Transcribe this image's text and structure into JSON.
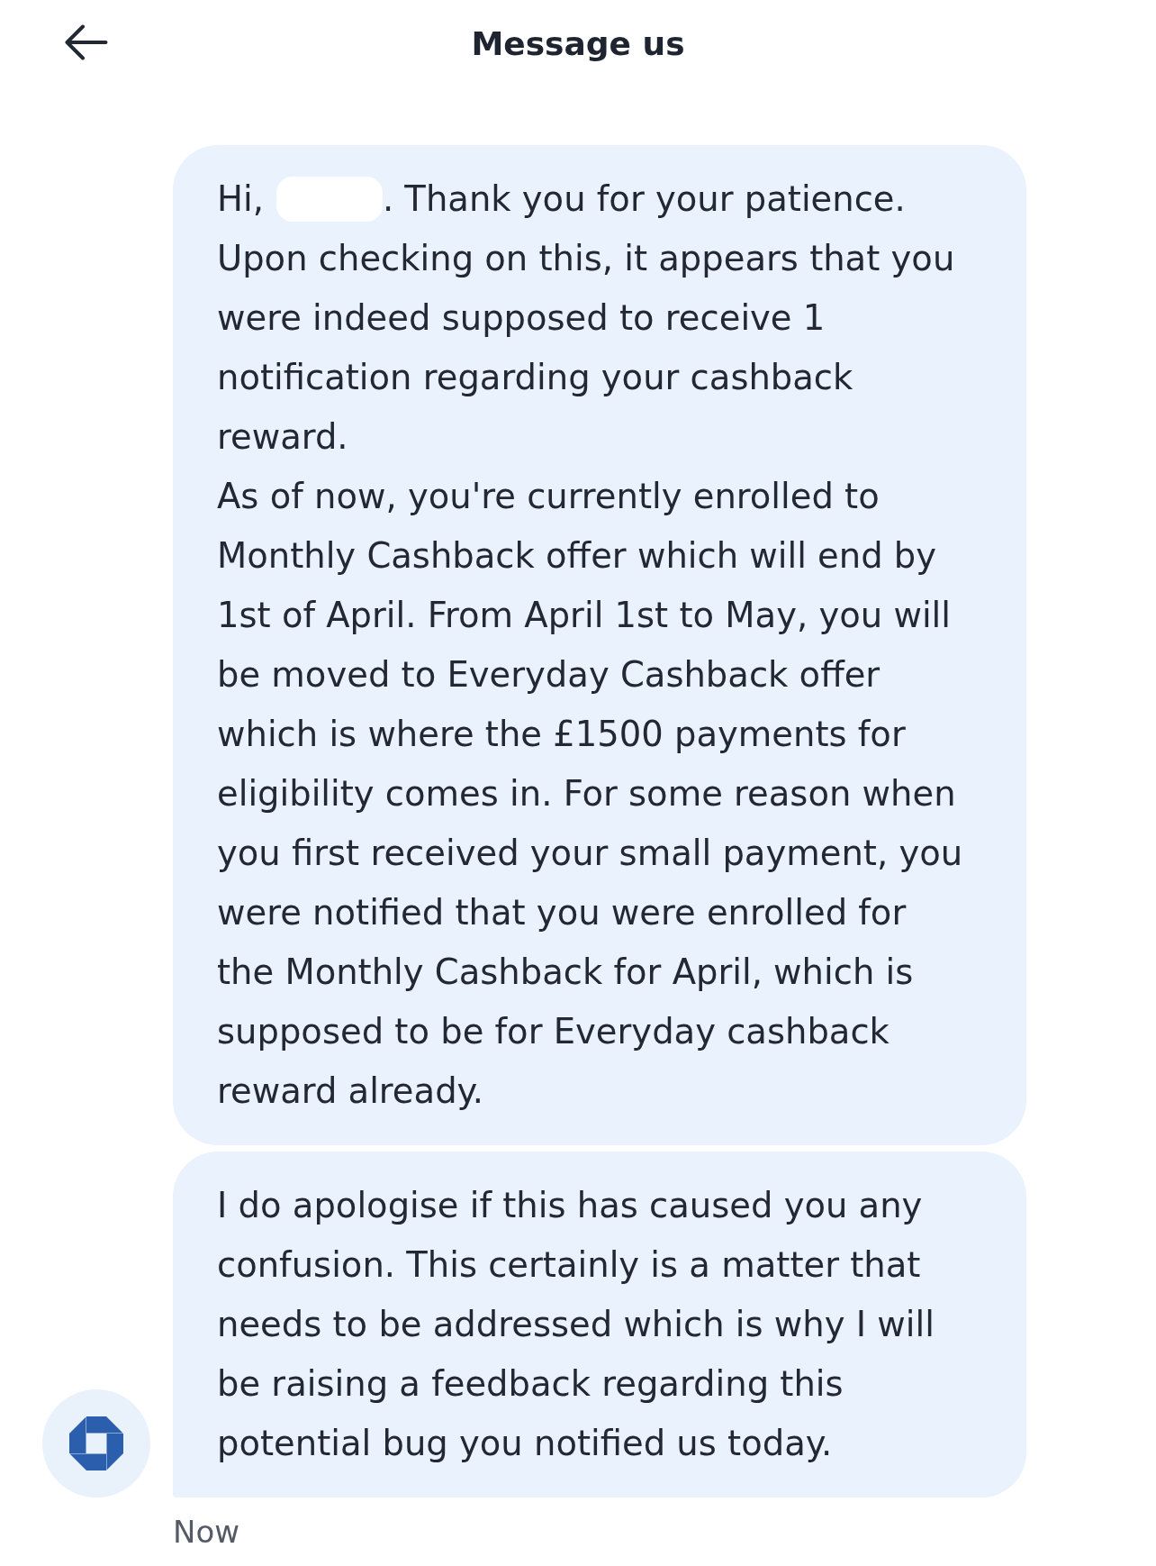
{
  "header": {
    "title": "Message us"
  },
  "messages": [
    {
      "greeting": {
        "before": "Hi,",
        "name_redacted": true,
        "after": ". Thank you for your patience."
      },
      "paragraphs": [
        "Upon checking on this, it appears that you were indeed supposed to receive 1 notification regarding your cashback reward.",
        "As of now, you're currently enrolled to Monthly Cashback offer which will end by 1st of April. From April 1st to May, you will be moved to Everyday Cashback offer which is where the £1500 payments for eligibility comes in. For some reason when you first received your small payment, you were notified that you were enrolled for the Monthly Cashback for April, which is supposed to be for Everyday cashback reward already."
      ]
    },
    {
      "paragraphs": [
        "I do apologise if this has caused you any confusion. This certainly is a matter that needs to be addressed which is why I will be raising a feedback regarding this potential bug you notified us today."
      ]
    }
  ],
  "timestamp": "Now"
}
